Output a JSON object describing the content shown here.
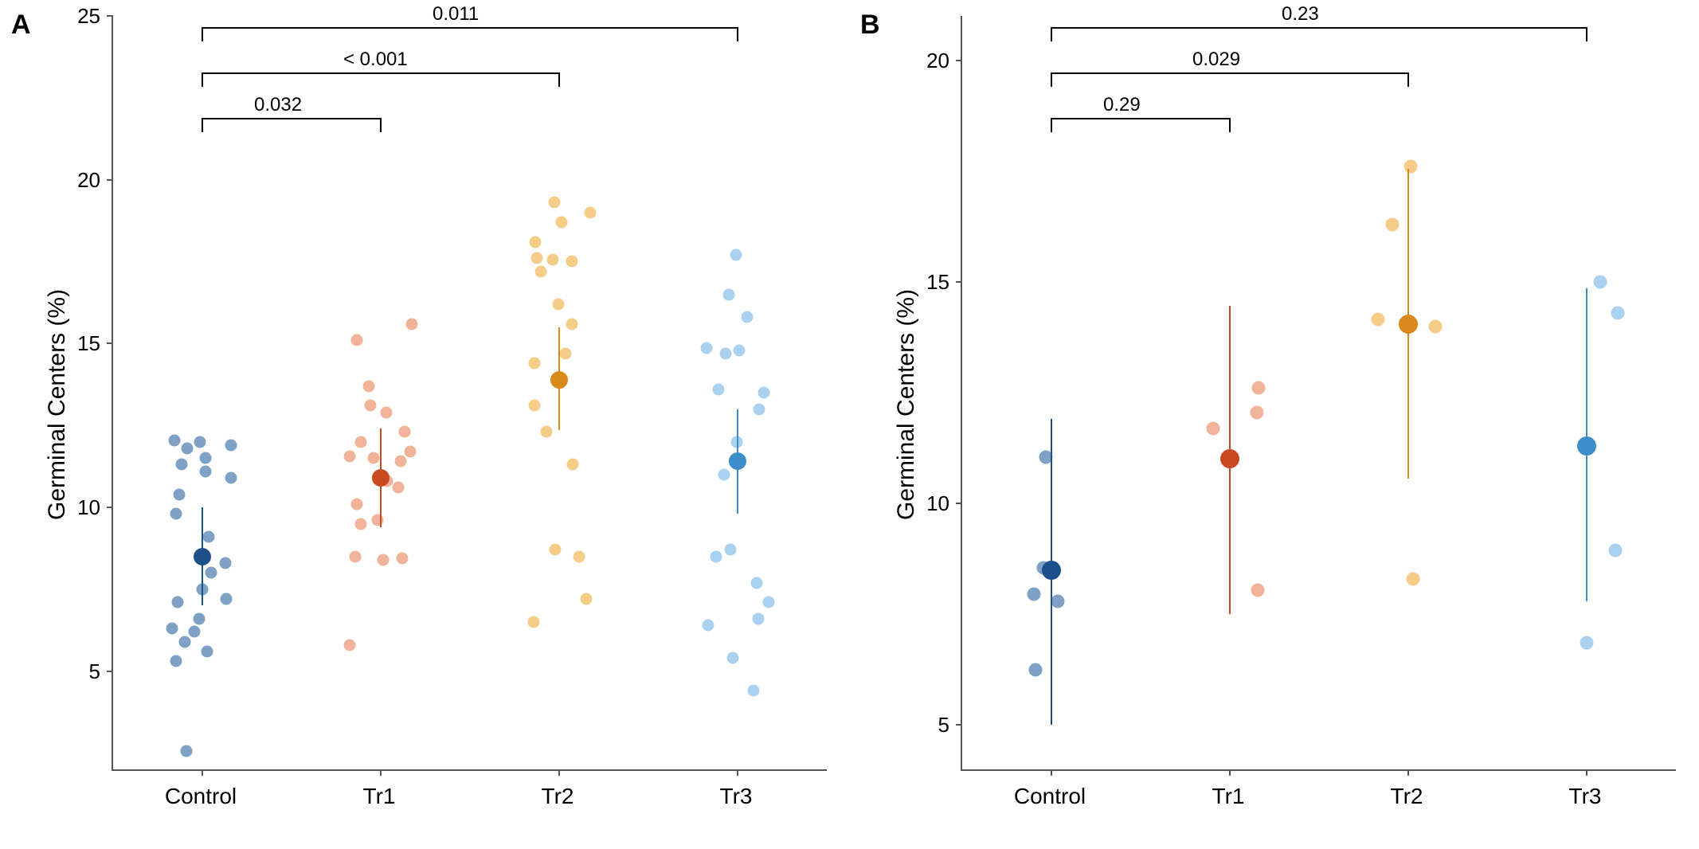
{
  "chart_data": [
    {
      "panel": "A",
      "type": "scatter",
      "ylabel": "Germinal Centers (%)",
      "ylim": [
        2,
        25
      ],
      "yticks": [
        5,
        10,
        15,
        20,
        25
      ],
      "categories": [
        "Control",
        "Tr1",
        "Tr2",
        "Tr3"
      ],
      "colors": {
        "Control": {
          "point": "#3b6fa8",
          "mean": "#1d4f8b"
        },
        "Tr1": {
          "point": "#e98a63",
          "mean": "#c94a20"
        },
        "Tr2": {
          "point": "#f0b24a",
          "mean": "#d88a1a"
        },
        "Tr3": {
          "point": "#7cb9e6",
          "mean": "#3b8ec9"
        }
      },
      "series": [
        {
          "name": "Control",
          "mean": 8.5,
          "ci": [
            7.0,
            10.0
          ],
          "values": [
            2.55,
            5.3,
            5.6,
            5.9,
            6.2,
            6.3,
            6.6,
            7.1,
            7.2,
            7.5,
            8.0,
            8.3,
            9.1,
            9.8,
            10.4,
            10.9,
            11.1,
            11.3,
            11.5,
            11.8,
            11.9,
            12.0,
            12.05
          ]
        },
        {
          "name": "Tr1",
          "mean": 10.9,
          "ci": [
            9.4,
            12.4
          ],
          "values": [
            5.8,
            8.4,
            8.45,
            8.5,
            9.5,
            9.6,
            10.1,
            10.6,
            10.8,
            11.4,
            11.5,
            11.55,
            11.7,
            12.0,
            12.3,
            12.9,
            13.1,
            13.7,
            15.1,
            15.6
          ]
        },
        {
          "name": "Tr2",
          "mean": 13.9,
          "ci": [
            12.35,
            15.5
          ],
          "values": [
            6.5,
            7.2,
            8.5,
            8.7,
            11.3,
            12.3,
            13.1,
            13.8,
            14.4,
            14.7,
            15.6,
            16.2,
            17.2,
            17.5,
            17.55,
            17.6,
            18.1,
            18.7,
            19.0,
            19.3
          ]
        },
        {
          "name": "Tr3",
          "mean": 11.4,
          "ci": [
            9.8,
            13.0
          ],
          "values": [
            4.4,
            5.4,
            6.4,
            6.6,
            7.1,
            7.7,
            8.5,
            8.7,
            11.0,
            12.0,
            13.0,
            13.5,
            13.6,
            14.7,
            14.8,
            14.85,
            15.8,
            16.5,
            17.7
          ]
        }
      ],
      "comparisons": [
        {
          "from": "Control",
          "to": "Tr1",
          "p": "0.032"
        },
        {
          "from": "Control",
          "to": "Tr2",
          "p": "< 0.001"
        },
        {
          "from": "Control",
          "to": "Tr3",
          "p": "0.011"
        }
      ]
    },
    {
      "panel": "B",
      "type": "scatter",
      "ylabel": "Germinal Centers (%)",
      "ylim": [
        4,
        21
      ],
      "yticks": [
        5,
        10,
        15,
        20
      ],
      "categories": [
        "Control",
        "Tr1",
        "Tr2",
        "Tr3"
      ],
      "colors": {
        "Control": {
          "point": "#3b6fa8",
          "mean": "#1d4f8b"
        },
        "Tr1": {
          "point": "#e98a63",
          "mean": "#c94a20"
        },
        "Tr2": {
          "point": "#f0b24a",
          "mean": "#d88a1a"
        },
        "Tr3": {
          "point": "#7cb9e6",
          "mean": "#3b8ec9"
        }
      },
      "series": [
        {
          "name": "Control",
          "mean": 8.5,
          "ci": [
            5.0,
            11.9
          ],
          "values": [
            6.25,
            7.8,
            7.95,
            8.55,
            11.05
          ]
        },
        {
          "name": "Tr1",
          "mean": 11.0,
          "ci": [
            7.5,
            14.45
          ],
          "values": [
            8.05,
            11.7,
            12.05,
            12.6
          ]
        },
        {
          "name": "Tr2",
          "mean": 14.05,
          "ci": [
            10.55,
            17.55
          ],
          "values": [
            8.3,
            14.0,
            14.15,
            16.3,
            17.6
          ]
        },
        {
          "name": "Tr3",
          "mean": 11.3,
          "ci": [
            7.8,
            14.85
          ],
          "values": [
            6.85,
            8.95,
            14.3,
            15.0
          ]
        }
      ],
      "comparisons": [
        {
          "from": "Control",
          "to": "Tr1",
          "p": "0.29"
        },
        {
          "from": "Control",
          "to": "Tr2",
          "p": "0.029"
        },
        {
          "from": "Control",
          "to": "Tr3",
          "p": "0.23"
        }
      ]
    }
  ]
}
